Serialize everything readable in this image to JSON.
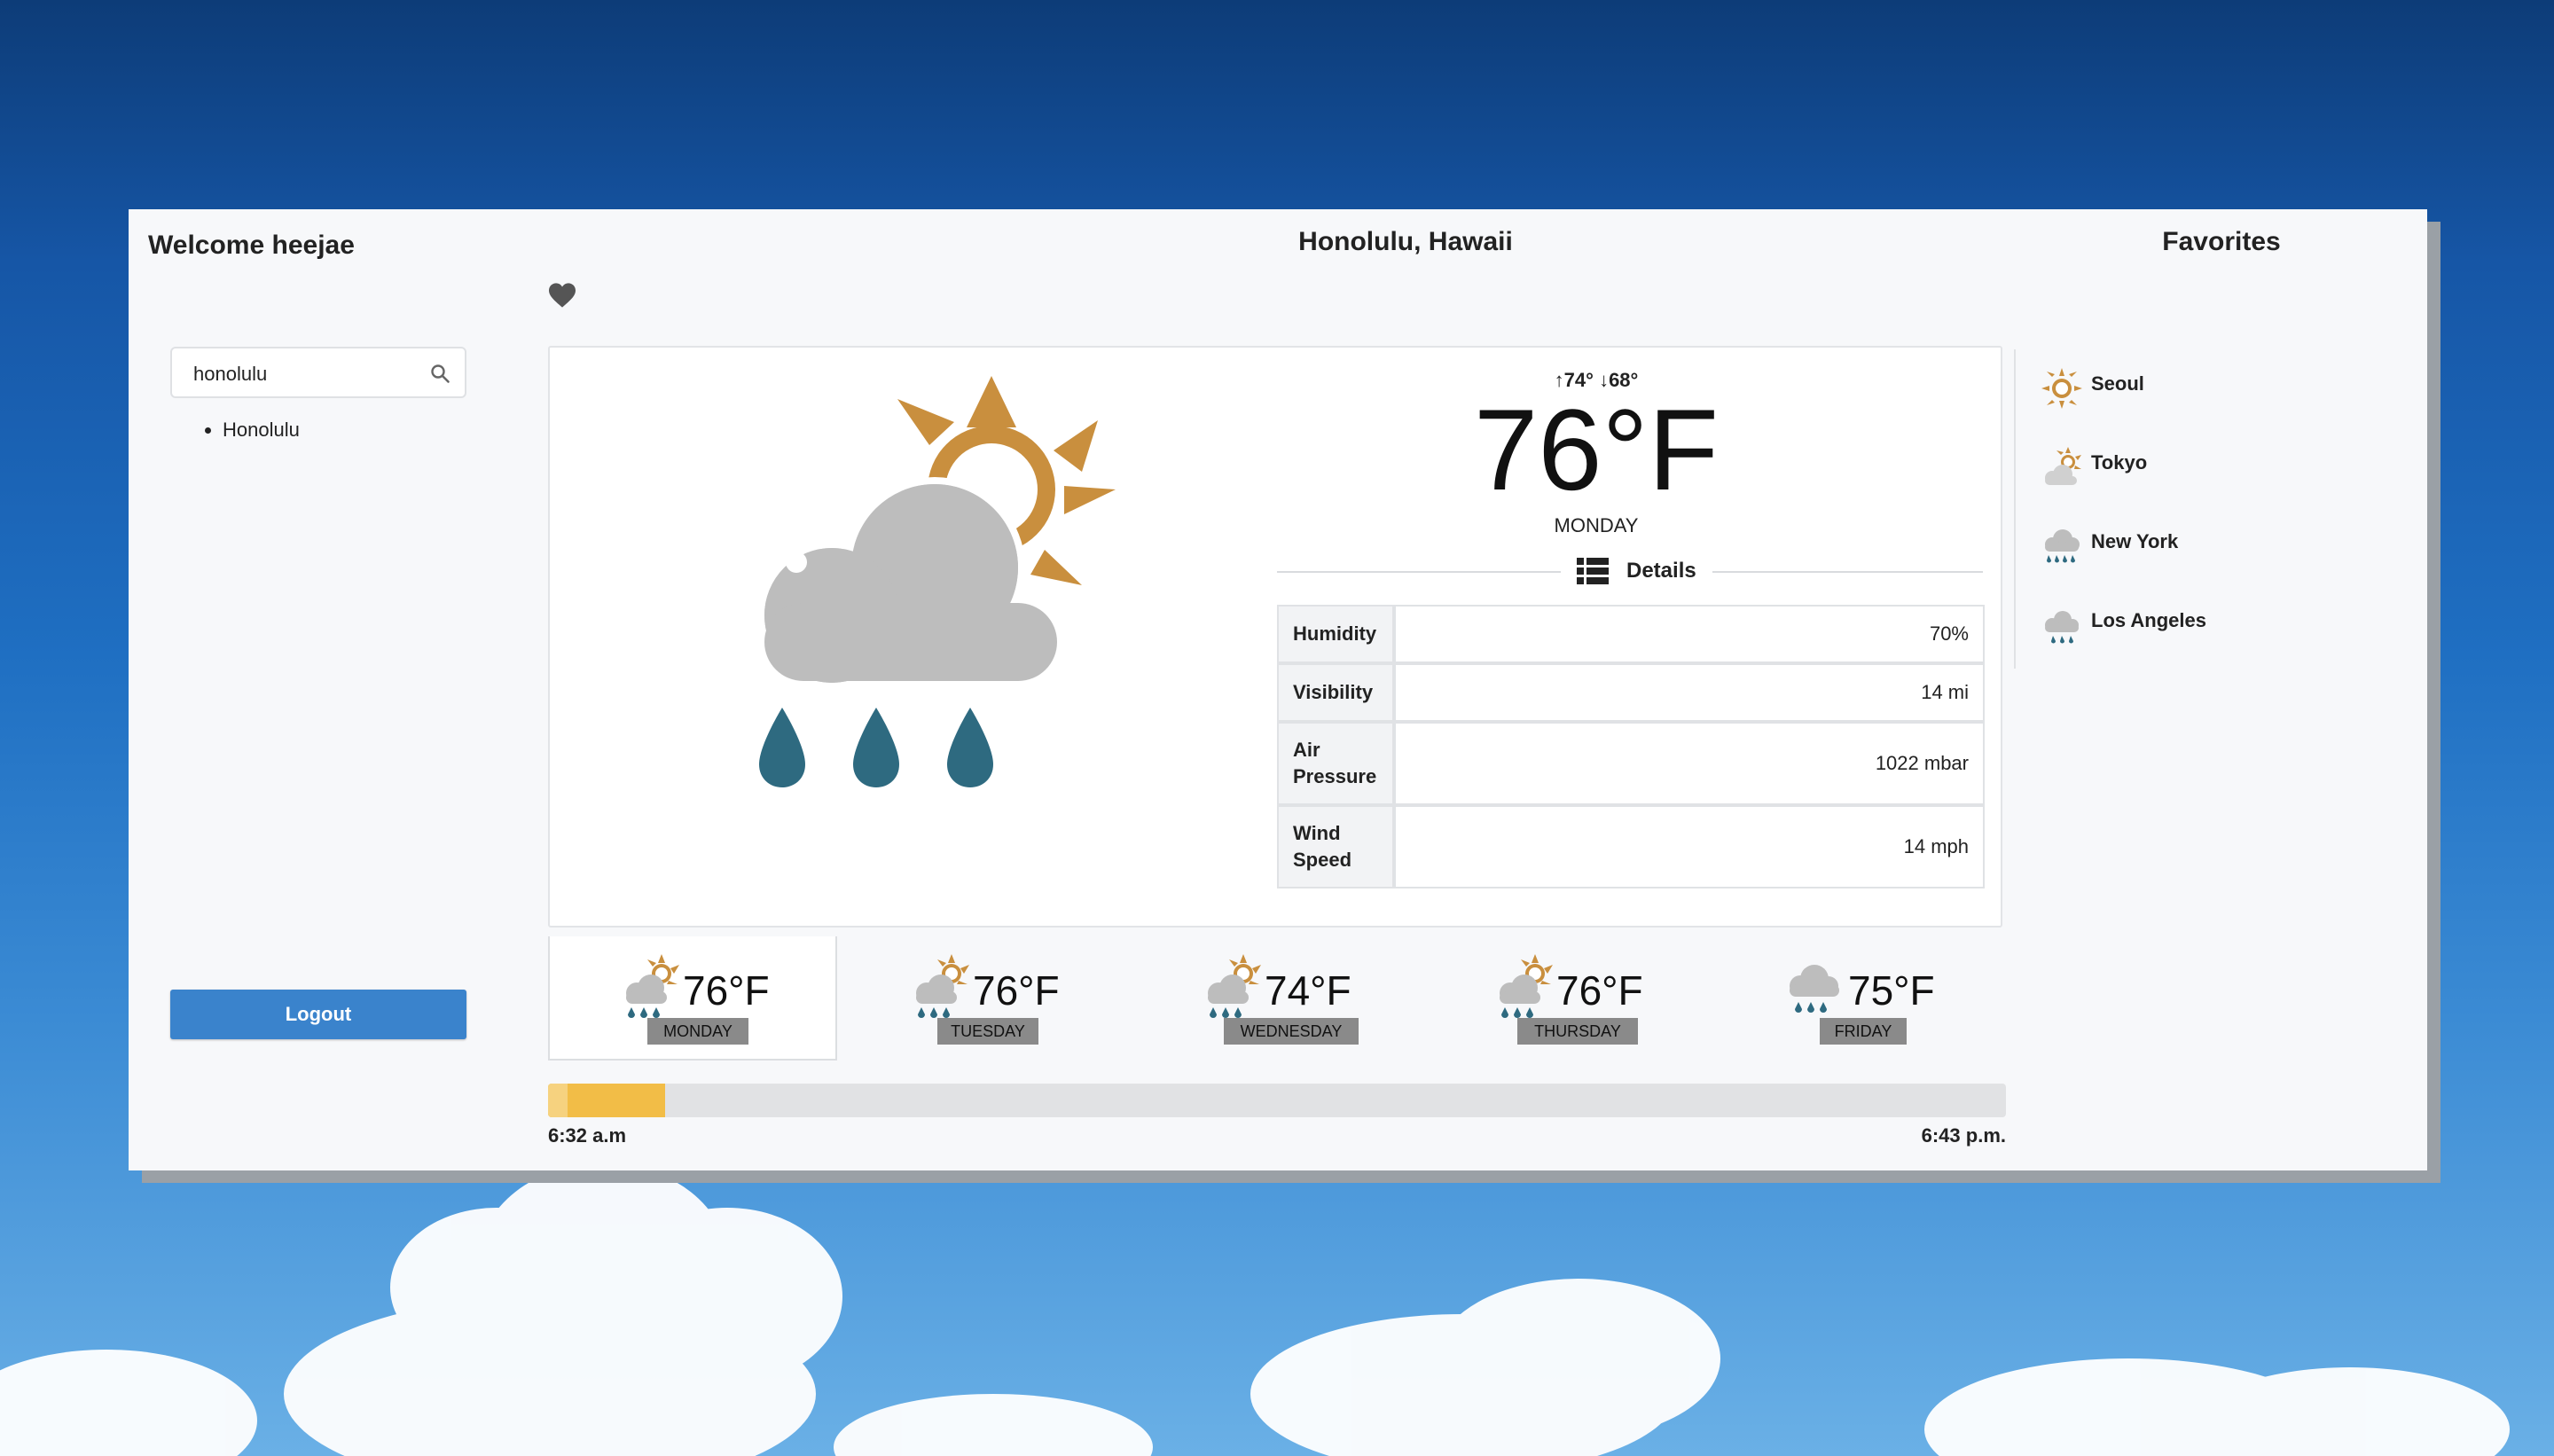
{
  "header": {
    "welcome": "Welcome heejae",
    "location": "Honolulu, Hawaii",
    "favorites_title": "Favorites"
  },
  "search": {
    "value": "honolulu",
    "results": [
      "Honolulu"
    ]
  },
  "logout_label": "Logout",
  "current": {
    "icon": "rain-partly-sunny-icon",
    "high": "↑74°",
    "low": "↓68°",
    "temp": "76°F",
    "day": "MONDAY",
    "details_label": "Details",
    "details": [
      {
        "label": "Humidity",
        "value": "70%"
      },
      {
        "label": "Visibility",
        "value": "14 mi"
      },
      {
        "label": "Air Pressure",
        "value": "1022 mbar"
      },
      {
        "label": "Wind Speed",
        "value": "14 mph"
      }
    ]
  },
  "forecast": [
    {
      "day": "MONDAY",
      "temp": "76°F",
      "icon": "rain-partly-sunny-icon",
      "active": true
    },
    {
      "day": "TUESDAY",
      "temp": "76°F",
      "icon": "rain-partly-sunny-icon",
      "active": false
    },
    {
      "day": "WEDNESDAY",
      "temp": "74°F",
      "icon": "rain-partly-sunny-icon",
      "active": false
    },
    {
      "day": "THURSDAY",
      "temp": "76°F",
      "icon": "rain-partly-sunny-icon",
      "active": false
    },
    {
      "day": "FRIDAY",
      "temp": "75°F",
      "icon": "rain-cloud-icon",
      "active": false
    }
  ],
  "daylight": {
    "sunrise": "6:32 a.m",
    "sunset": "6:43 p.m.",
    "progress_fraction": 0.08
  },
  "favorites": [
    {
      "name": "Seoul",
      "icon": "sun-icon"
    },
    {
      "name": "Tokyo",
      "icon": "partly-sunny-icon"
    },
    {
      "name": "New York",
      "icon": "rain-cloud-icon"
    },
    {
      "name": "Los Angeles",
      "icon": "rain-cloud-icon"
    }
  ],
  "colors": {
    "sun": "#c98f3e",
    "cloud": "#bdbdbd",
    "rain": "#2e6a80",
    "accent_button": "#3a83cc",
    "daylight_fill": "#f2bd47"
  }
}
